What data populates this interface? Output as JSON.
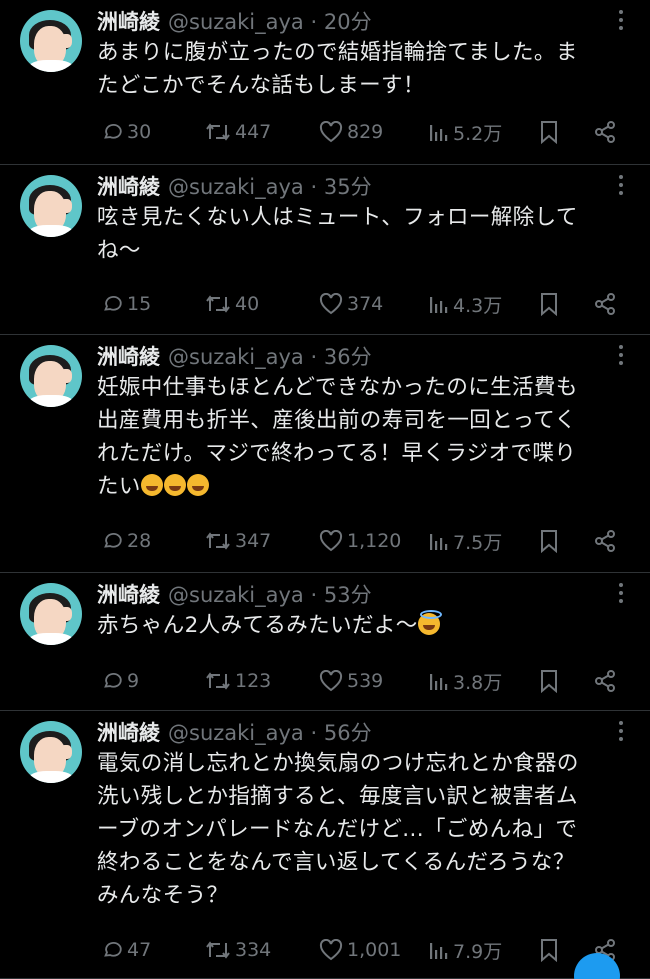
{
  "account": {
    "name": "洲崎綾",
    "handle": "@suzaki_aya"
  },
  "tweets": [
    {
      "time": "20分",
      "text_lines": [
        "あまりに腹が立ったので結婚指輪捨てました。ま",
        "たどこかでそんな話もしまーす！"
      ],
      "emoji": [],
      "replies": "30",
      "retweets": "447",
      "likes": "829",
      "views": "5.2万"
    },
    {
      "time": "35分",
      "text_lines": [
        "呟き見たくない人はミュート、フォロー解除して",
        "ね〜"
      ],
      "emoji": [],
      "replies": "15",
      "retweets": "40",
      "likes": "374",
      "views": "4.3万"
    },
    {
      "time": "36分",
      "text_lines": [
        "妊娠中仕事もほとんどできなかったのに生活費も",
        "出産費用も折半、産後出前の寿司を一回とってく",
        "れただけ。マジで終わってる！早くラジオで喋り",
        "たい"
      ],
      "emoji": [
        "rolling-on-floor-laughing",
        "rolling-on-floor-laughing",
        "rolling-on-floor-laughing"
      ],
      "replies": "28",
      "retweets": "347",
      "likes": "1,120",
      "views": "7.5万"
    },
    {
      "time": "53分",
      "text_lines": [
        "赤ちゃん2人みてるみたいだよ〜"
      ],
      "emoji": [
        "smiling-face-with-halo"
      ],
      "replies": "9",
      "retweets": "123",
      "likes": "539",
      "views": "3.8万"
    },
    {
      "time": "56分",
      "text_lines": [
        "電気の消し忘れとか換気扇のつけ忘れとか食器の",
        "洗い残しとか指摘すると、毎度言い訳と被害者ム",
        "ーブのオンパレードなんだけど...「ごめんね」で",
        "終わることをなんで言い返してくるんだろうな？",
        "みんなそう？"
      ],
      "emoji": [],
      "replies": "47",
      "retweets": "334",
      "likes": "1,001",
      "views": "7.9万"
    }
  ],
  "colors": {
    "background": "#000000",
    "text": "#e7e9ea",
    "muted": "#71767b",
    "divider": "#2f3336",
    "avatar_bg": "#5fc6c9"
  }
}
